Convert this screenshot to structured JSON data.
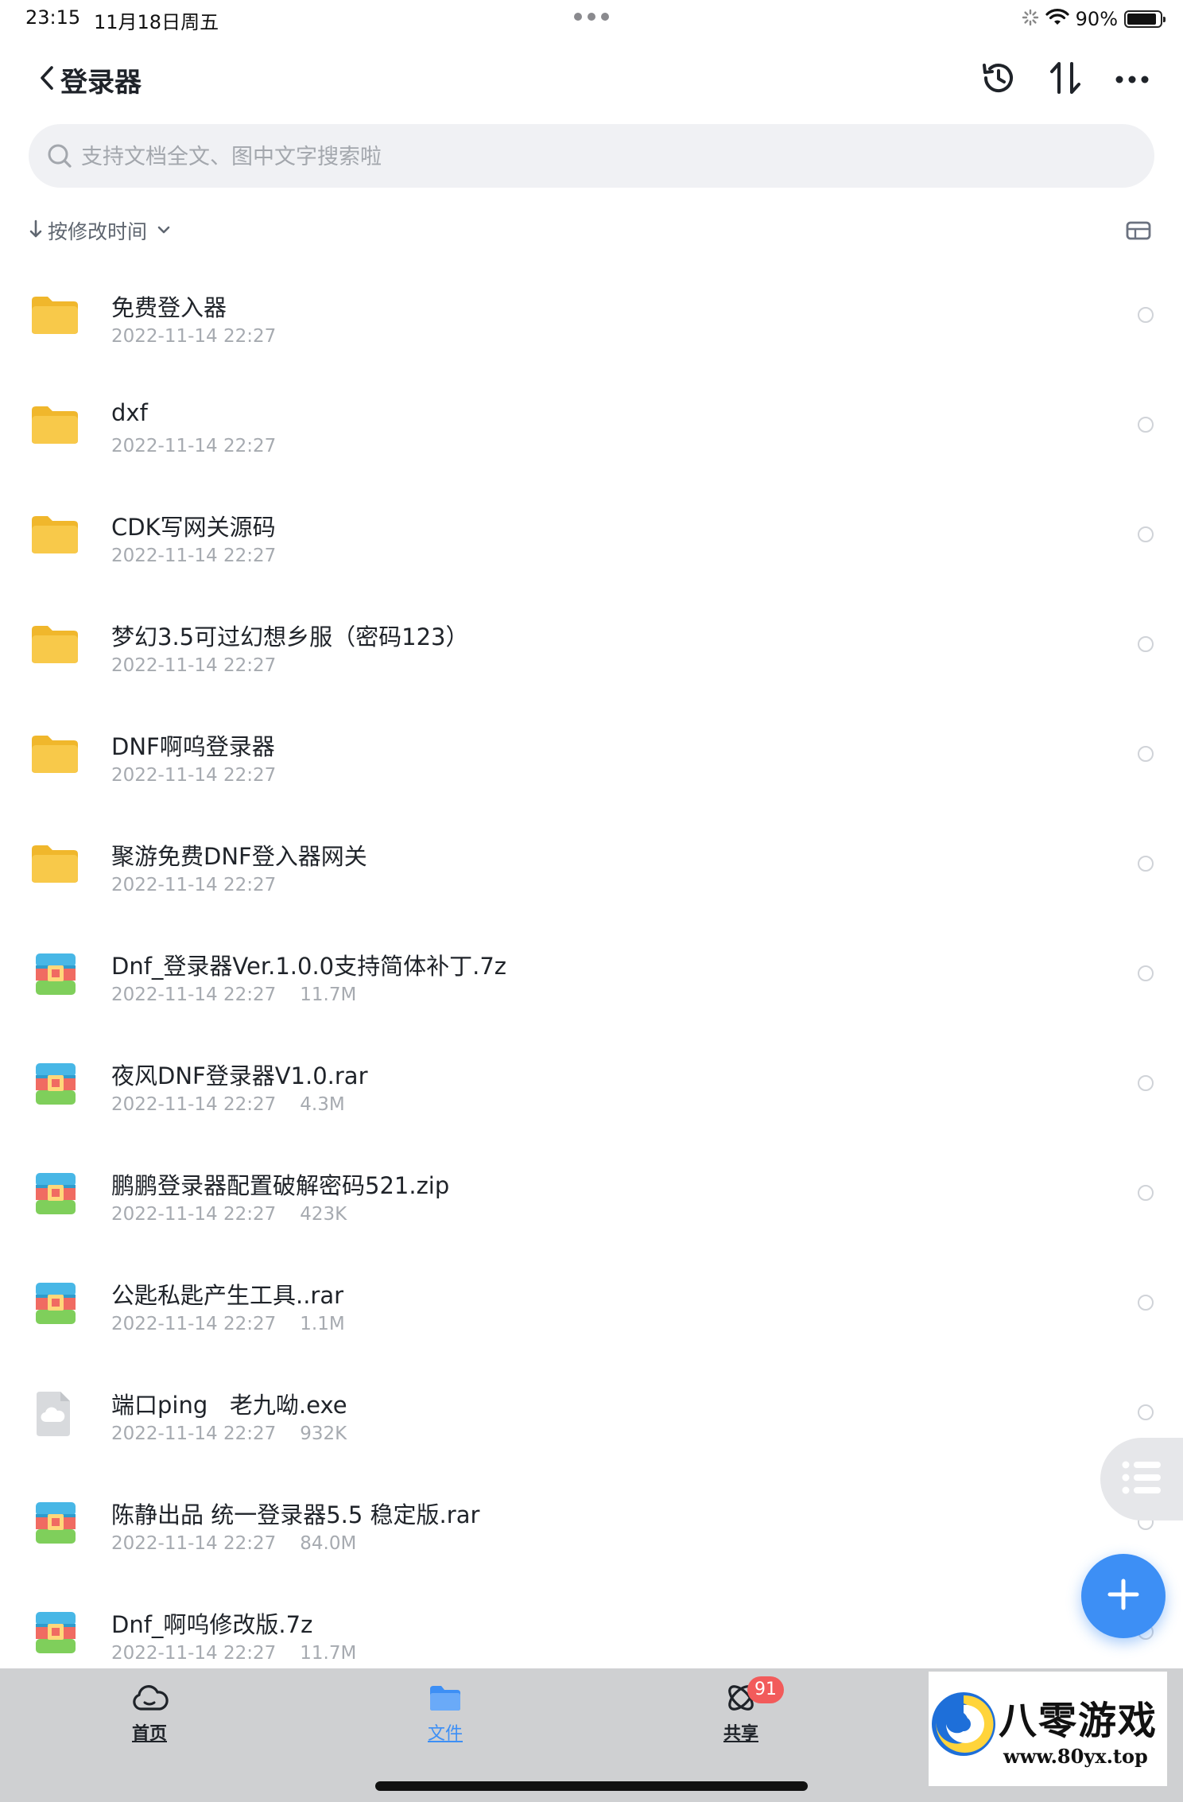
{
  "status_bar": {
    "time": "23:15",
    "date": "11月18日周五",
    "battery_percent": "90%",
    "battery_level": 0.9
  },
  "header": {
    "title": "登录器",
    "icons": [
      "chevron-left-icon",
      "history-icon",
      "sort-icon",
      "more-icon"
    ]
  },
  "search": {
    "placeholder": "支持文档全文、图中文字搜索啦"
  },
  "sort": {
    "label": "按修改时间"
  },
  "files": [
    {
      "name": "免费登入器",
      "date": "2022-11-14 22:27",
      "size": "",
      "type": "folder"
    },
    {
      "name": "dxf",
      "date": "2022-11-14 22:27",
      "size": "",
      "type": "folder"
    },
    {
      "name": "CDK写网关源码",
      "date": "2022-11-14 22:27",
      "size": "",
      "type": "folder"
    },
    {
      "name": "梦幻3.5可过幻想乡服（密码123）",
      "date": "2022-11-14 22:27",
      "size": "",
      "type": "folder"
    },
    {
      "name": "DNF啊呜登录器",
      "date": "2022-11-14 22:27",
      "size": "",
      "type": "folder"
    },
    {
      "name": "聚游免费DNF登入器网关",
      "date": "2022-11-14 22:27",
      "size": "",
      "type": "folder"
    },
    {
      "name": "Dnf_登录器Ver.1.0.0支持简体补丁.7z",
      "date": "2022-11-14 22:27",
      "size": "11.7M",
      "type": "archive"
    },
    {
      "name": "夜风DNF登录器V1.0.rar",
      "date": "2022-11-14 22:27",
      "size": "4.3M",
      "type": "archive"
    },
    {
      "name": "鹏鹏登录器配置破解密码521.zip",
      "date": "2022-11-14 22:27",
      "size": "423K",
      "type": "archive"
    },
    {
      "name": "公匙私匙产生工具..rar",
      "date": "2022-11-14 22:27",
      "size": "1.1M",
      "type": "archive"
    },
    {
      "name": "端口ping   老九呦.exe",
      "date": "2022-11-14 22:27",
      "size": "932K",
      "type": "exe"
    },
    {
      "name": "陈静出品 统一登录器5.5 稳定版.rar",
      "date": "2022-11-14 22:27",
      "size": "84.0M",
      "type": "archive"
    },
    {
      "name": "Dnf_啊呜修改版.7z",
      "date": "2022-11-14 22:27",
      "size": "11.7M",
      "type": "archive"
    }
  ],
  "tabs": [
    {
      "label": "首页",
      "icon": "cloud-icon",
      "active": false
    },
    {
      "label": "文件",
      "icon": "folder-icon",
      "active": true
    },
    {
      "label": "共享",
      "icon": "share-icon",
      "active": false,
      "badge": "91"
    }
  ],
  "watermark": {
    "text": "八零游戏",
    "url": "www.80yx.top"
  },
  "colors": {
    "accent": "#3d8ff5",
    "folder": "#f8c94a",
    "badge": "#f25b5b",
    "tabbar_bg": "#cfd0d2"
  }
}
